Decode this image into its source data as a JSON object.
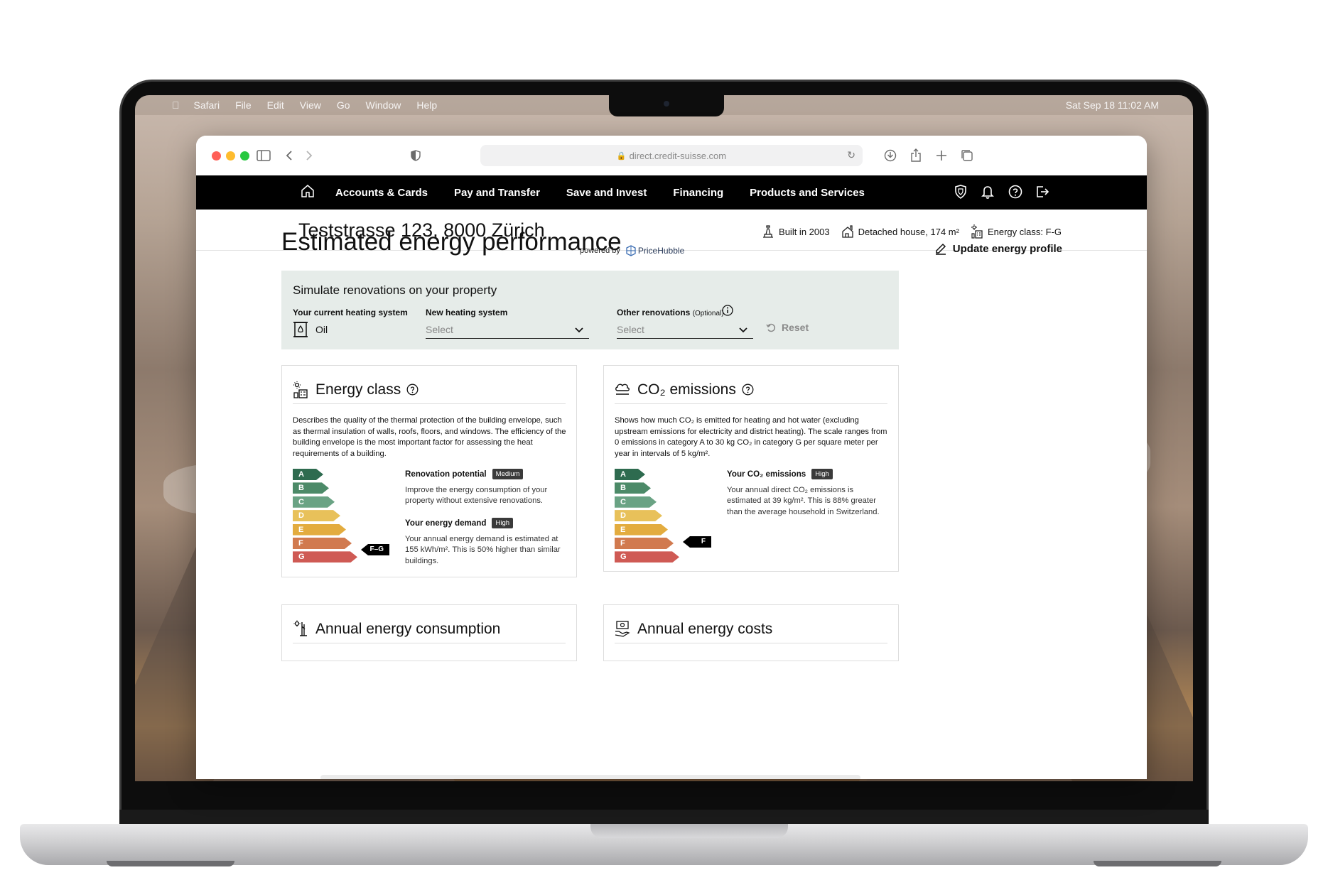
{
  "menubar": {
    "items": [
      "Safari",
      "File",
      "Edit",
      "View",
      "Go",
      "Window",
      "Help"
    ],
    "clock": "Sat Sep 18  11:02 AM"
  },
  "browser": {
    "url": "direct.credit-suisse.com"
  },
  "nav": {
    "links": [
      "Accounts & Cards",
      "Pay and Transfer",
      "Save and Invest",
      "Financing",
      "Products and Services"
    ]
  },
  "property": {
    "address": "Teststrasse 123, 8000 Zürich",
    "facts": [
      "Built in 2003",
      "Detached house, 174 m²",
      "Energy class: F-G"
    ]
  },
  "main": {
    "title": "Estimated energy performance",
    "powered_by": "powered by",
    "provider": "PriceHubble",
    "update_label": "Update energy profile"
  },
  "simulate": {
    "title": "Simulate renovations on your property",
    "current_label": "Your current heating system",
    "current_value": "Oil",
    "new_label": "New heating system",
    "new_placeholder": "Select",
    "other_label": "Other renovations",
    "other_optional": "(Optional)",
    "other_placeholder": "Select",
    "reset_label": "Reset"
  },
  "scale_colors": {
    "A": "#2e6b4f",
    "B": "#4c8a68",
    "C": "#6aa384",
    "D": "#e8c15a",
    "E": "#e3ac3f",
    "F": "#d17a4f",
    "G": "#cf5a54"
  },
  "energy_card": {
    "title": "Energy class",
    "description": "Describes the quality of the thermal protection of the building envelope, such as thermal insulation of walls, roofs, floors, and windows. The efficiency of the building envelope is the most important factor for assessing the heat requirements of a building.",
    "classes": [
      "A",
      "B",
      "C",
      "D",
      "E",
      "F",
      "G"
    ],
    "marker": "F–G",
    "potential_label": "Renovation potential",
    "potential_badge": "Medium",
    "potential_text": "Improve the energy consumption of your property without extensive renovations.",
    "demand_label": "Your energy demand",
    "demand_badge": "High",
    "demand_text": "Your annual energy demand is estimated at 155 kWh/m². This is 50% higher than similar buildings."
  },
  "co2_card": {
    "title": "CO₂ emissions",
    "description": "Shows how much CO₂ is emitted for heating and hot water (excluding upstream emissions for electricity and district heating). The scale ranges from 0 emissions in category A to 30 kg CO₂ in category G per square meter per year in intervals of 5 kg/m².",
    "classes": [
      "A",
      "B",
      "C",
      "D",
      "E",
      "F",
      "G"
    ],
    "marker": "F",
    "emissions_label": "Your CO₂ emissions",
    "emissions_badge": "High",
    "emissions_text": "Your annual direct CO₂ emissions is estimated at 39 kg/m². This is 88% greater than the average household in Switzerland."
  },
  "bottom_cards": {
    "consumption_title": "Annual energy consumption",
    "costs_title": "Annual energy costs"
  }
}
